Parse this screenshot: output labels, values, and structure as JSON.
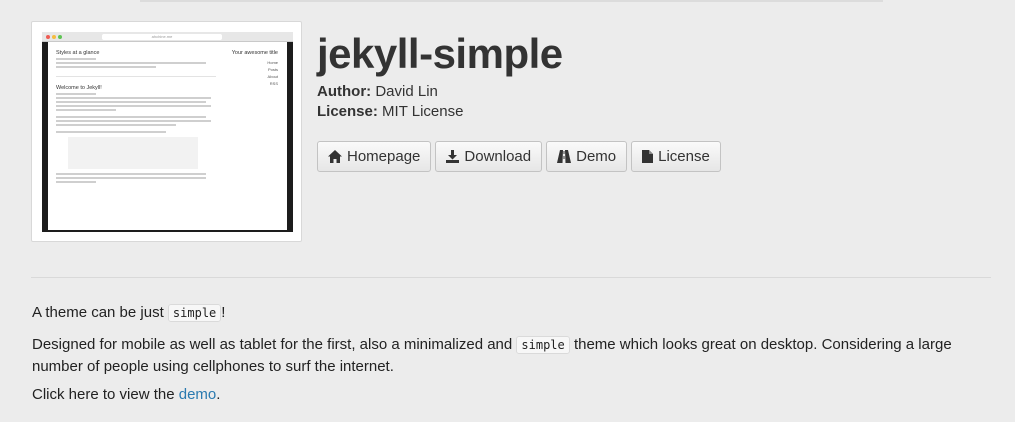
{
  "thumbnail": {
    "url": "ahchine.me",
    "post_title": "Styles at a glance",
    "post2_title": "Welcome to Jekyll!",
    "side_title": "Your awesome title",
    "side_links": [
      "Home",
      "Posts",
      "About",
      "RSS"
    ]
  },
  "project": {
    "title": "jekyll-simple",
    "author_label": "Author:",
    "author": "David Lin",
    "license_label": "License:",
    "license": "MIT License"
  },
  "buttons": {
    "homepage": "Homepage",
    "download": "Download",
    "demo": "Demo",
    "license": "License"
  },
  "description": {
    "p1_before": "A theme can be just",
    "p1_code": "simple",
    "p1_after": "!",
    "p2_before": "Designed for mobile as well as tablet for the first, also a minimalized and",
    "p2_code": "simple",
    "p2_after": "theme which looks great on desktop. Considering a large number of people using cellphones to surf the internet.",
    "p3_before": "Click here to view the",
    "p3_link": "demo",
    "p3_after": "."
  },
  "colors": {
    "background": "#ececec",
    "link": "#2a7ab0"
  }
}
